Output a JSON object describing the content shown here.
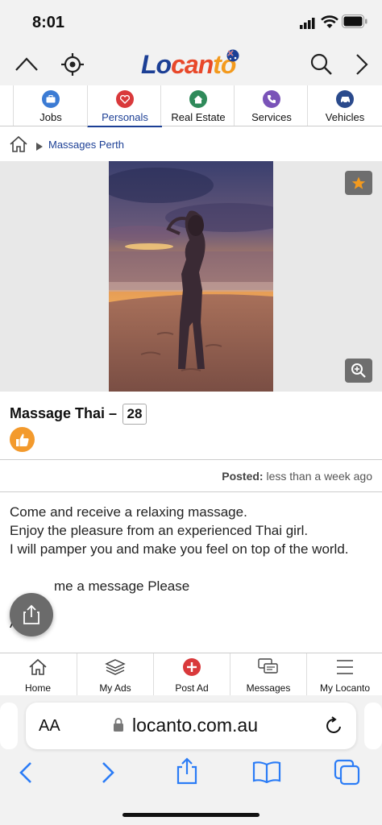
{
  "status_bar": {
    "time": "8:01"
  },
  "top_nav": {
    "logo_parts": [
      "Lo",
      "can",
      "to"
    ],
    "icons": [
      "chevron-up-icon",
      "locate-icon",
      "search-icon",
      "chevron-right-icon"
    ]
  },
  "categories": [
    {
      "label": "Jobs",
      "icon": "briefcase-icon",
      "color": "#3b7bd4"
    },
    {
      "label": "Personals",
      "icon": "heart-icon",
      "color": "#d9393b",
      "active": true
    },
    {
      "label": "Real Estate",
      "icon": "house-icon",
      "color": "#2f8a5a"
    },
    {
      "label": "Services",
      "icon": "phone-icon",
      "color": "#7a53b8"
    },
    {
      "label": "Vehicles",
      "icon": "car-icon",
      "color": "#2a4a8c"
    }
  ],
  "breadcrumb": {
    "item": "Massages Perth"
  },
  "listing": {
    "title": "Massage Thai –",
    "age": "28",
    "posted_label": "Posted:",
    "posted_value": "less than a week ago",
    "description": [
      "Come and receive a relaxing massage.",
      "Enjoy the pleasure from an experienced Thai girl.",
      "I will pamper you and make you feel on top of the world.",
      "",
      "me a message Please",
      "",
      "Ascot:"
    ]
  },
  "bottom_tabs": [
    {
      "label": "Home",
      "icon": "home-icon"
    },
    {
      "label": "My Ads",
      "icon": "stack-icon"
    },
    {
      "label": "Post Ad",
      "icon": "plus-circle-icon"
    },
    {
      "label": "Messages",
      "icon": "messages-icon"
    },
    {
      "label": "My Locanto",
      "icon": "menu-icon"
    }
  ],
  "browser": {
    "text_size_label": "AA",
    "url": "locanto.com.au"
  },
  "colors": {
    "brand_blue": "#1c3f95",
    "brand_red": "#e8482a",
    "brand_orange": "#f39a1e",
    "accent": "#f39a2d",
    "safari_blue": "#2b7cf6"
  }
}
